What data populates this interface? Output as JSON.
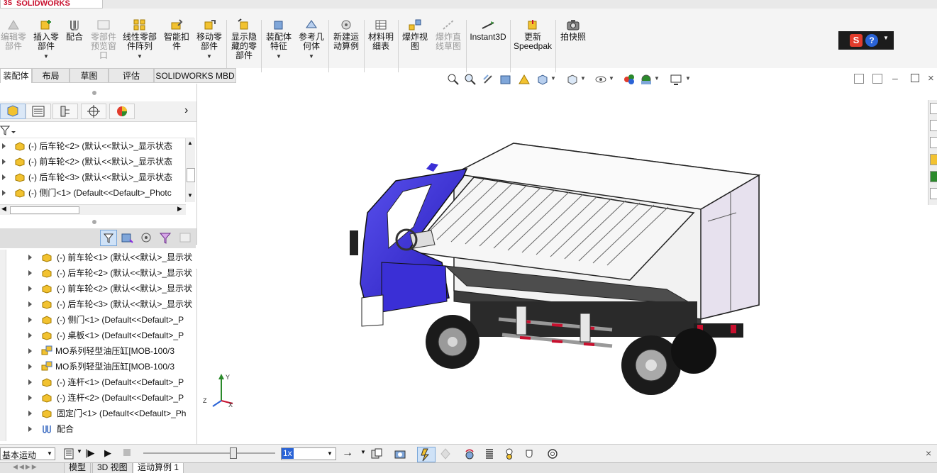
{
  "app": {
    "logo_text": "SOLIDWORKS",
    "logo_prefix": "3S"
  },
  "ribbon": {
    "buttons": [
      {
        "label": "编辑零\n部件",
        "disabled": true
      },
      {
        "label": "插入零\n部件",
        "disabled": false
      },
      {
        "label": "配合",
        "disabled": false
      },
      {
        "label": "零部件\n预览窗\n口",
        "disabled": true
      },
      {
        "label": "线性零部\n件阵列",
        "disabled": false
      },
      {
        "label": "智能扣\n件",
        "disabled": false
      },
      {
        "label": "移动零\n部件",
        "disabled": false
      },
      {
        "label": "显示隐\n藏的零\n部件",
        "disabled": false
      },
      {
        "label": "装配体\n特征",
        "disabled": false
      },
      {
        "label": "参考几\n何体",
        "disabled": false
      },
      {
        "label": "新建运\n动算例",
        "disabled": false
      },
      {
        "label": "材料明\n细表",
        "disabled": false
      },
      {
        "label": "爆炸视\n图",
        "disabled": false
      },
      {
        "label": "爆炸直\n线草图",
        "disabled": true
      },
      {
        "label": "Instant3D",
        "disabled": false
      },
      {
        "label": "更新\nSpeedpak",
        "disabled": false
      },
      {
        "label": "拍快照",
        "disabled": false
      }
    ],
    "help_s": "S",
    "help_q": "?"
  },
  "tabs": [
    "装配体",
    "布局",
    "草图",
    "评估",
    "SOLIDWORKS MBD"
  ],
  "active_tab": "装配体",
  "tree_upper": [
    {
      "label": "(-) 后车轮<2> (默认<<默认>_显示状态"
    },
    {
      "label": "(-) 前车轮<2> (默认<<默认>_显示状态"
    },
    {
      "label": "(-) 后车轮<3> (默认<<默认>_显示状态"
    },
    {
      "label": "(-) 侧门<1> (Default<<Default>_Photc"
    }
  ],
  "tree_lower": [
    {
      "label": "(-) 前车轮<1> (默认<<默认>_显示状",
      "icon": "part"
    },
    {
      "label": "(-) 后车轮<2> (默认<<默认>_显示状",
      "icon": "part"
    },
    {
      "label": "(-) 前车轮<2> (默认<<默认>_显示状",
      "icon": "part"
    },
    {
      "label": "(-) 后车轮<3> (默认<<默认>_显示状",
      "icon": "part"
    },
    {
      "label": "(-) 侧门<1> (Default<<Default>_P",
      "icon": "part"
    },
    {
      "label": "(-) 桌板<1> (Default<<Default>_P",
      "icon": "part"
    },
    {
      "label": "MO系列轻型油压缸[MOB-100/3",
      "icon": "subassembly"
    },
    {
      "label": "MO系列轻型油压缸[MOB-100/3",
      "icon": "subassembly"
    },
    {
      "label": "(-) 连杆<1> (Default<<Default>_P",
      "icon": "part"
    },
    {
      "label": "(-) 连杆<2> (Default<<Default>_P",
      "icon": "part"
    },
    {
      "label": "固定门<1> (Default<<Default>_Ph",
      "icon": "part"
    },
    {
      "label": "配合",
      "icon": "mates"
    }
  ],
  "triad": {
    "x": "X",
    "y": "Y",
    "z": "Z"
  },
  "motion": {
    "study_type": "基本运动",
    "speed": "1x"
  },
  "bottom_tabs": [
    "模型",
    "3D 视图",
    "运动算例 1"
  ],
  "active_bottom_tab": "运动算例 1",
  "colors": {
    "cab_blue": "#3a2fd6",
    "accent": "#2a63d6",
    "ribbon_bg": "#f4f4f4"
  }
}
